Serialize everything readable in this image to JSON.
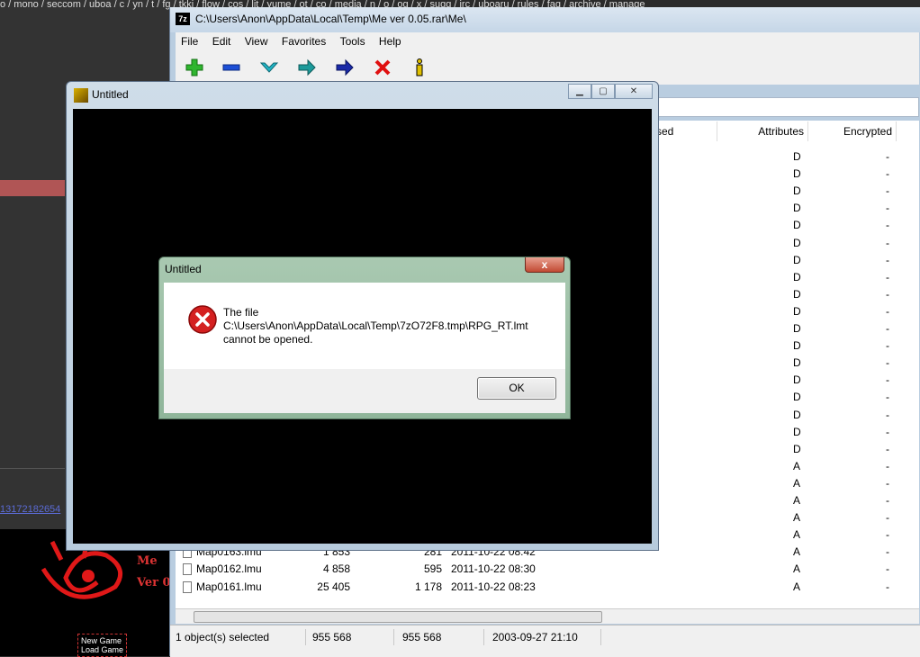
{
  "background": {
    "navbar": "o / mono / seccom / uboa / c / yn / t / fg / tkki / flow / cos / lit / yume / ot / co / media / n / o / og / x / sugg / irc / uboaru / rules / faq / archive / manage",
    "link_text": "13172182654",
    "game": {
      "title": "Me",
      "version": "Ver 0",
      "menu": [
        "New Game",
        "Load Game"
      ]
    }
  },
  "archive_window": {
    "title": "C:\\Users\\Anon\\AppData\\Local\\Temp\\Me ver 0.05.rar\\Me\\",
    "menu": [
      "File",
      "Edit",
      "View",
      "Favorites",
      "Tools",
      "Help"
    ],
    "toolbar": [
      {
        "icon": "add-icon",
        "color": "#2fb52f"
      },
      {
        "icon": "extract-icon",
        "color": "#1c4fd6"
      },
      {
        "icon": "test-icon",
        "color": "#22b5c6"
      },
      {
        "icon": "copy-icon",
        "color": "#1c9a9a"
      },
      {
        "icon": "move-icon",
        "color": "#1a2aa8"
      },
      {
        "icon": "delete-icon",
        "color": "#e01010"
      },
      {
        "icon": "info-icon",
        "color": "#e0c000"
      }
    ],
    "columns": {
      "packed_partial": "sed",
      "attributes": "Attributes",
      "encrypted": "Encrypted"
    },
    "rows": [
      {
        "name": "",
        "size": "",
        "packed": "",
        "modified": "",
        "attr": "D",
        "enc": "-"
      },
      {
        "name": "",
        "size": "",
        "packed": "",
        "modified": "",
        "attr": "D",
        "enc": "-"
      },
      {
        "name": "",
        "size": "",
        "packed": "",
        "modified": "",
        "attr": "D",
        "enc": "-"
      },
      {
        "name": "",
        "size": "",
        "packed": "",
        "modified": "",
        "attr": "D",
        "enc": "-"
      },
      {
        "name": "",
        "size": "",
        "packed": "",
        "modified": "",
        "attr": "D",
        "enc": "-"
      },
      {
        "name": "",
        "size": "",
        "packed": "",
        "modified": "",
        "attr": "D",
        "enc": "-"
      },
      {
        "name": "",
        "size": "",
        "packed": "",
        "modified": "",
        "attr": "D",
        "enc": "-"
      },
      {
        "name": "",
        "size": "",
        "packed": "",
        "modified": "",
        "attr": "D",
        "enc": "-"
      },
      {
        "name": "",
        "size": "",
        "packed": "",
        "modified": "",
        "attr": "D",
        "enc": "-"
      },
      {
        "name": "",
        "size": "",
        "packed": "",
        "modified": "",
        "attr": "D",
        "enc": "-"
      },
      {
        "name": "",
        "size": "",
        "packed": "",
        "modified": "",
        "attr": "D",
        "enc": "-"
      },
      {
        "name": "",
        "size": "",
        "packed": "",
        "modified": "",
        "attr": "D",
        "enc": "-"
      },
      {
        "name": "",
        "size": "",
        "packed": "",
        "modified": "",
        "attr": "D",
        "enc": "-"
      },
      {
        "name": "",
        "size": "",
        "packed": "",
        "modified": "",
        "attr": "D",
        "enc": "-"
      },
      {
        "name": "",
        "size": "",
        "packed": "",
        "modified": "",
        "attr": "D",
        "enc": "-"
      },
      {
        "name": "",
        "size": "",
        "packed": "",
        "modified": "",
        "attr": "D",
        "enc": "-"
      },
      {
        "name": "",
        "size": "",
        "packed": "",
        "modified": "",
        "attr": "D",
        "enc": "-"
      },
      {
        "name": "",
        "size": "",
        "packed": "",
        "modified": "",
        "attr": "D",
        "enc": "-"
      },
      {
        "name": "",
        "size": "",
        "packed": "",
        "modified": "",
        "attr": "A",
        "enc": "-"
      },
      {
        "name": "",
        "size": "",
        "packed": "",
        "modified": "",
        "attr": "A",
        "enc": "-"
      },
      {
        "name": "",
        "size": "",
        "packed": "",
        "modified": "",
        "attr": "A",
        "enc": "-"
      },
      {
        "name": "",
        "size": "",
        "packed": "",
        "modified": "",
        "attr": "A",
        "enc": "-"
      },
      {
        "name": "",
        "size": "",
        "packed": "",
        "modified": "",
        "attr": "A",
        "enc": "-"
      },
      {
        "name": "Map0163.lmu",
        "size": "1 853",
        "packed": "281",
        "modified": "2011-10-22 08:42",
        "attr": "A",
        "enc": "-"
      },
      {
        "name": "Map0162.lmu",
        "size": "4 858",
        "packed": "595",
        "modified": "2011-10-22 08:30",
        "attr": "A",
        "enc": "-"
      },
      {
        "name": "Map0161.lmu",
        "size": "25 405",
        "packed": "1 178",
        "modified": "2011-10-22 08:23",
        "attr": "A",
        "enc": "-"
      }
    ],
    "status": {
      "selected": "1 object(s) selected",
      "size": "955 568",
      "packed": "955 568",
      "modified": "2003-09-27 21:10"
    }
  },
  "game_window": {
    "title": "Untitled"
  },
  "error_dialog": {
    "title": "Untitled",
    "close_label": "x",
    "message_line1": "The file",
    "message_line2": "C:\\Users\\Anon\\AppData\\Local\\Temp\\7zO72F8.tmp\\RPG_RT.lmt",
    "message_line3": "cannot be opened.",
    "ok_label": "OK"
  }
}
